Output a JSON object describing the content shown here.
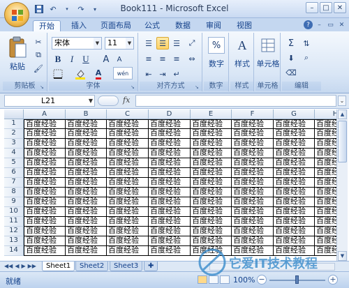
{
  "title": "Book111 - Microsoft Excel",
  "window_buttons": [
    "–",
    "□",
    "✕"
  ],
  "tabs": [
    "开始",
    "插入",
    "页面布局",
    "公式",
    "数据",
    "审阅",
    "视图"
  ],
  "active_tab": "开始",
  "ribbon": {
    "clipboard": {
      "label": "剪贴板",
      "paste": "粘贴"
    },
    "font": {
      "label": "字体",
      "font_name": "宋体",
      "font_size": "11",
      "bold": "B",
      "italic": "I",
      "underline": "U",
      "grow": "A",
      "shrink": "A",
      "font_color_letter": "A",
      "phonetic": "wén"
    },
    "alignment": {
      "label": "对齐方式"
    },
    "number": {
      "label": "数字",
      "percent": "%"
    },
    "styles": {
      "label": "样式",
      "icon_letter": "A"
    },
    "cells": {
      "label": "单元格"
    },
    "editing": {
      "label": "编辑",
      "sum": "Σ"
    }
  },
  "formula_bar": {
    "name_box": "L21",
    "fx": "fx",
    "content": ""
  },
  "columns": [
    "A",
    "B",
    "C",
    "D",
    "E",
    "F",
    "G",
    "H"
  ],
  "rows": [
    "1",
    "2",
    "3",
    "4",
    "5",
    "6",
    "7",
    "8",
    "9",
    "10",
    "11",
    "12",
    "13",
    "14"
  ],
  "cell_text": "百度经验",
  "sheets": [
    "Sheet1",
    "Sheet2",
    "Sheet3"
  ],
  "active_sheet": "Sheet1",
  "status": {
    "ready": "就绪",
    "zoom": "100%"
  },
  "watermark_text": "它爱IT技术教程"
}
